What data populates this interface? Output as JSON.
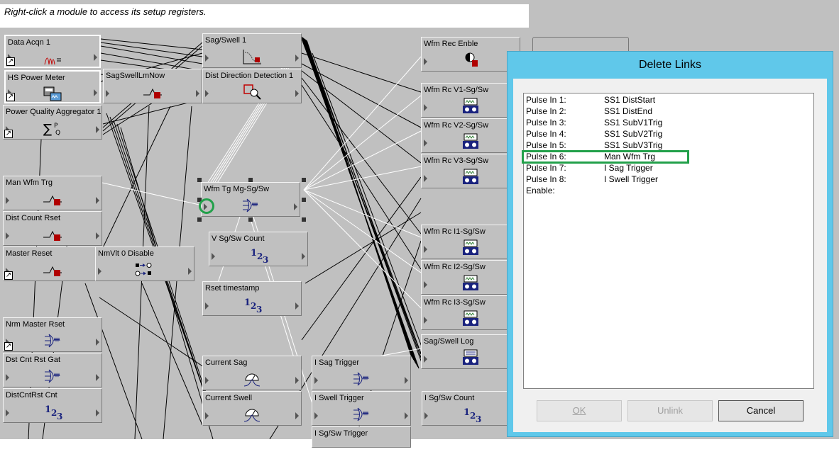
{
  "hint": "Right-click a module to access its setup registers.",
  "modules": [
    {
      "id": "data-acqn-1",
      "label": "Data Acqn 1",
      "icon": "data-acqn-icon",
      "shortcut": true,
      "highlight": true
    },
    {
      "id": "hs-power-meter",
      "label": "HS Power Meter",
      "icon": "power-meter-icon",
      "shortcut": true,
      "highlight": true
    },
    {
      "id": "power-quality-aggregator-1",
      "label": "Power Quality Aggregator 1",
      "icon": "sum-pq-icon",
      "shortcut": true
    },
    {
      "id": "sagswelllmnow",
      "label": "SagSwellLmNow",
      "icon": "pulse-red-icon"
    },
    {
      "id": "sag-swell-1",
      "label": "Sag/Swell 1",
      "icon": "sag-swell-chart-icon"
    },
    {
      "id": "dist-direction-detection-1",
      "label": "Dist Direction Detection 1",
      "icon": "direction-magnifier-icon"
    },
    {
      "id": "wfm-rec-enble",
      "label": "Wfm Rec Enble",
      "icon": "half-circle-red-icon"
    },
    {
      "id": "wfm-rc-v1",
      "label": "Wfm Rc V1-Sg/Sw",
      "icon": "tape-recorder-icon"
    },
    {
      "id": "wfm-rc-v2",
      "label": "Wfm Rc V2-Sg/Sw",
      "icon": "tape-recorder-icon"
    },
    {
      "id": "wfm-rc-v3",
      "label": "Wfm Rc V3-Sg/Sw",
      "icon": "tape-recorder-icon"
    },
    {
      "id": "man-wfm-trg",
      "label": "Man Wfm Trg",
      "icon": "pulse-red-icon"
    },
    {
      "id": "dist-count-rset",
      "label": "Dist Count Rset",
      "icon": "pulse-red-icon"
    },
    {
      "id": "master-reset",
      "label": "Master Reset",
      "icon": "pulse-red-icon",
      "shortcut": true
    },
    {
      "id": "nmvlt-0-disable",
      "label": "NmVlt 0 Disable",
      "icon": "logic-gate-icon"
    },
    {
      "id": "wfm-tg-mg",
      "label": "Wfm Tg Mg-Sg/Sw",
      "icon": "or-gate-icon"
    },
    {
      "id": "v-sg-sw-count",
      "label": "V Sg/Sw Count",
      "icon": "counter-icon"
    },
    {
      "id": "rset-timestamp",
      "label": "Rset timestamp",
      "icon": "counter-icon"
    },
    {
      "id": "wfm-rc-i1",
      "label": "Wfm Rc I1-Sg/Sw",
      "icon": "tape-recorder-icon"
    },
    {
      "id": "wfm-rc-i2",
      "label": "Wfm Rc I2-Sg/Sw",
      "icon": "tape-recorder-icon"
    },
    {
      "id": "wfm-rc-i3",
      "label": "Wfm Rc I3-Sg/Sw",
      "icon": "tape-recorder-icon"
    },
    {
      "id": "nrm-master-rset",
      "label": "Nrm Master Rset",
      "icon": "or-gate-icon",
      "shortcut": true
    },
    {
      "id": "dst-cnt-rst-gat",
      "label": "Dst Cnt Rst Gat",
      "icon": "or-gate-icon"
    },
    {
      "id": "distcntrst-cnt",
      "label": "DistCntRst Cnt",
      "icon": "counter-icon"
    },
    {
      "id": "sag-swell-log",
      "label": "Sag/Swell Log",
      "icon": "log-recorder-icon"
    },
    {
      "id": "current-sag",
      "label": "Current Sag",
      "icon": "meter-gauge-icon"
    },
    {
      "id": "current-swell",
      "label": "Current Swell",
      "icon": "meter-gauge-icon"
    },
    {
      "id": "i-sag-trigger",
      "label": "I Sag Trigger",
      "icon": "or-gate-icon"
    },
    {
      "id": "i-swell-trigger",
      "label": "I Swell Trigger",
      "icon": "or-gate-icon"
    },
    {
      "id": "i-sg-sw-trigger",
      "label": "I Sg/Sw Trigger",
      "icon": "or-gate-icon"
    },
    {
      "id": "i-sg-sw-count",
      "label": "I Sg/Sw Count",
      "icon": "counter-icon"
    }
  ],
  "counter_glyph": "1₂₃",
  "sum_glyph": "∑",
  "pq_glyph": "P/Q",
  "dialog": {
    "title": "Delete Links",
    "links": [
      {
        "input": "Pulse In 1:",
        "source": "SS1 DistStart"
      },
      {
        "input": "Pulse In 2:",
        "source": "SS1 DistEnd"
      },
      {
        "input": "Pulse In 3:",
        "source": "SS1 SubV1Trig"
      },
      {
        "input": "Pulse In 4:",
        "source": "SS1 SubV2Trig"
      },
      {
        "input": "Pulse In 5:",
        "source": "SS1 SubV3Trig"
      },
      {
        "input": "Pulse In 6:",
        "source": "Man Wfm Trg"
      },
      {
        "input": "Pulse In 7:",
        "source": "I Sag Trigger"
      },
      {
        "input": "Pulse In 8:",
        "source": "I Swell Trigger"
      },
      {
        "input": "Enable:",
        "source": ""
      }
    ],
    "selected_index": 5,
    "ok_label": "OK",
    "unlink_label": "Unlink",
    "cancel_label": "Cancel",
    "highlight_color": "#22a04a"
  }
}
